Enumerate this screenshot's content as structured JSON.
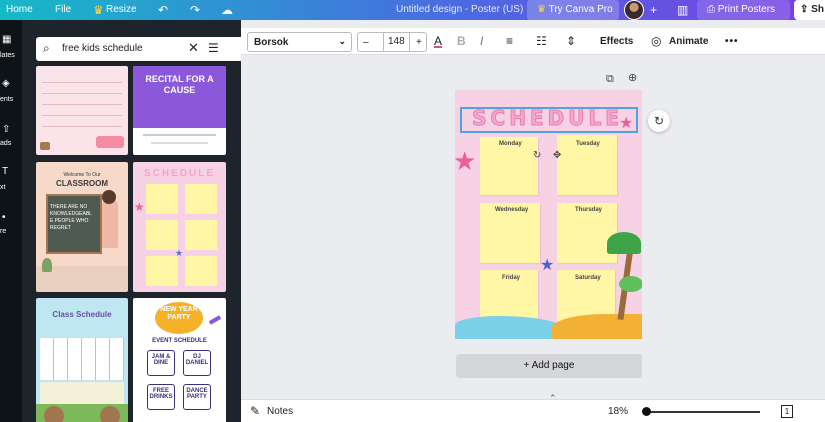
{
  "menubar": {
    "home": "Home",
    "file": "File",
    "resize": "Resize",
    "doc_title": "Untitled design - Poster (US)",
    "try_pro": "Try Canva Pro",
    "print": "Print Posters",
    "share": "Sh"
  },
  "rail": {
    "items": [
      "lates",
      "ents",
      "ads",
      "xt",
      "re"
    ]
  },
  "search": {
    "value": "free kids schedule"
  },
  "templates": {
    "t1_lines": [
      "Welcome To Our",
      "CLASSROOM",
      "THERE ARE NO",
      "KNOWLEDGEABL",
      "E PEOPLE WHO",
      "REGRET"
    ],
    "t2_title": "RECITAL FOR A CAUSE",
    "t3_title": "SCHEDULE",
    "t3_days": [
      "Monday",
      "Tuesday",
      "Wednesday",
      "Thursday",
      "Friday",
      "Saturday"
    ],
    "t4_title": "Class Schedule",
    "t5_title": "NEW YEAR PARTY",
    "t5_sub": "EVENT SCHEDULE",
    "t5_items": [
      "JAM & DINE",
      "DJ DANIEL",
      "FREE DRINKS",
      "DANCE PARTY"
    ]
  },
  "toolbar": {
    "font": "Borsok",
    "minus": "–",
    "size": "148",
    "plus": "+",
    "bold": "B",
    "italic": "I",
    "effects": "Effects",
    "animate": "Animate",
    "more": "•••"
  },
  "poster": {
    "title": "SCHEDULE",
    "days": [
      "Monday",
      "Tuesday",
      "Wednesday",
      "Thursday",
      "Friday",
      "Saturday"
    ]
  },
  "canvas": {
    "add_page": "+ Add page"
  },
  "bottombar": {
    "notes": "Notes",
    "zoom": "18%",
    "page": "1"
  },
  "colors": {
    "accent_gradient_start": "#16b9c7",
    "accent_gradient_end": "#7b3fe4",
    "poster_bg": "#f7d2e4",
    "note_yellow": "#fff6a6",
    "title_pink": "#f7a6cf",
    "selection": "#4fa3e0"
  },
  "icons": [
    "home-icon",
    "crown-icon",
    "undo-icon",
    "redo-icon",
    "cloud-icon",
    "plus-icon",
    "chart-icon",
    "print-icon",
    "share-icon",
    "search-icon",
    "close-icon",
    "filter-icon",
    "text-color-icon",
    "align-icon",
    "list-icon",
    "spacing-icon",
    "animate-icon",
    "rotate-icon",
    "move-icon",
    "copy-icon",
    "add-icon",
    "regenerate-icon",
    "notes-icon",
    "chevron-up-icon"
  ]
}
